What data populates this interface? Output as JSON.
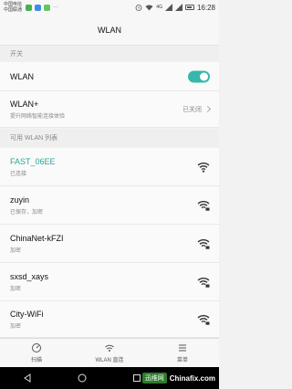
{
  "status_bar": {
    "carrier_1": "中国电信",
    "carrier_2": "中国联通",
    "signal": "4G",
    "time": "16:28"
  },
  "title": "WLAN",
  "sections": {
    "switch_header": "开关",
    "list_header": "可用 WLAN 列表"
  },
  "wlan_toggle": {
    "label": "WLAN",
    "on": true
  },
  "wlan_plus": {
    "label": "WLAN+",
    "subtitle": "提升网络智能连接体验",
    "state": "已关闭"
  },
  "networks": [
    {
      "ssid": "FAST_06EE",
      "status": "已连接",
      "active": true
    },
    {
      "ssid": "zuyin",
      "status": "已保存，加密",
      "active": false
    },
    {
      "ssid": "ChinaNet-kFZI",
      "status": "加密",
      "active": false
    },
    {
      "ssid": "sxsd_xays",
      "status": "加密",
      "active": false
    },
    {
      "ssid": "City-WiFi",
      "status": "加密",
      "active": false
    }
  ],
  "bottom_nav": {
    "scan": "扫描",
    "wlan_direct": "WLAN 直连",
    "menu": "菜单"
  },
  "watermark": {
    "badge": "迅维网",
    "site": "Chinafix.com"
  },
  "colors": {
    "accent": "#36b8ac",
    "active_text": "#2aa69b",
    "background": "#f2f2f2"
  }
}
